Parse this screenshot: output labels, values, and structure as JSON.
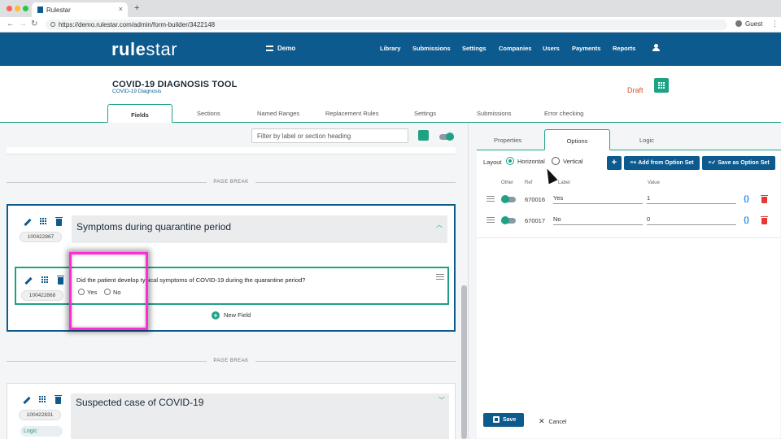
{
  "browser": {
    "tab_title": "Rulestar",
    "url": "https://demo.rulestar.com/admin/form-builder/3422148",
    "profile": "Guest"
  },
  "header": {
    "logo_left": "rule",
    "logo_right": "star",
    "workspace": "Demo",
    "nav": [
      "Library",
      "Submissions",
      "Settings",
      "Companies",
      "Users",
      "Payments",
      "Reports"
    ]
  },
  "page": {
    "title": "COVID-19 DIAGNOSIS TOOL",
    "subtitle": "COVID-19 Diagnosis",
    "status": "Draft"
  },
  "main_tabs": [
    "Fields",
    "Sections",
    "Named Ranges",
    "Replacement Rules",
    "Settings",
    "Submissions",
    "Error checking"
  ],
  "builder": {
    "filter_placeholder": "Filter by label or section heading",
    "page_break": "PAGE BREAK",
    "new_field": "New Field",
    "sections": [
      {
        "id": "100422867",
        "title": "Symptoms during quarantine period",
        "field": {
          "id": "100422868",
          "question": "Did the patient develop typical symptoms of COVID-19 during the quarantine period?",
          "options": [
            "Yes",
            "No"
          ]
        }
      },
      {
        "id": "100422831",
        "title": "Suspected case of COVID-19",
        "logic_label": "Logic"
      }
    ]
  },
  "properties": {
    "tabs": [
      "Properties",
      "Options",
      "Logic"
    ],
    "layout_label": "Layout",
    "layout_options": [
      "Horizontal",
      "Vertical"
    ],
    "add_button": "+",
    "add_from_set": "Add from Option Set",
    "save_as_set": "Save as Option Set",
    "columns": [
      "Other",
      "Ref",
      "Label",
      "Value"
    ],
    "rows": [
      {
        "ref": "670016",
        "label": "Yes",
        "value": "1"
      },
      {
        "ref": "670017",
        "label": "No",
        "value": "0"
      }
    ],
    "braces": "{}",
    "save": "Save",
    "cancel": "Cancel"
  },
  "colors": {
    "brand_blue": "#0d5a8e",
    "accent_green": "#1fa284",
    "draft_orange": "#d9532c",
    "highlight_magenta": "#ff2bd6",
    "delete_red": "#e53935"
  }
}
